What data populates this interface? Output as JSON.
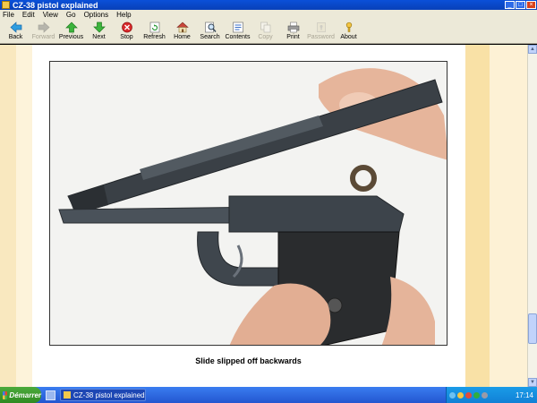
{
  "window": {
    "title": "CZ-38 pistol explained"
  },
  "menu": [
    "File",
    "Edit",
    "View",
    "Go",
    "Options",
    "Help"
  ],
  "toolbar": [
    {
      "label": "Back",
      "icon": "back-arrow-icon",
      "enabled": true
    },
    {
      "label": "Forward",
      "icon": "forward-arrow-icon",
      "enabled": false
    },
    {
      "label": "Previous",
      "icon": "up-arrow-icon",
      "enabled": true
    },
    {
      "label": "Next",
      "icon": "down-arrow-icon",
      "enabled": true
    },
    {
      "label": "Stop",
      "icon": "stop-icon",
      "enabled": true
    },
    {
      "label": "Refresh",
      "icon": "refresh-icon",
      "enabled": true
    },
    {
      "label": "Home",
      "icon": "home-icon",
      "enabled": true
    },
    {
      "label": "Search",
      "icon": "search-icon",
      "enabled": true
    },
    {
      "label": "Contents",
      "icon": "contents-icon",
      "enabled": true
    },
    {
      "label": "Copy",
      "icon": "copy-icon",
      "enabled": false
    },
    {
      "label": "Print",
      "icon": "print-icon",
      "enabled": true
    },
    {
      "label": "Password",
      "icon": "password-icon",
      "enabled": false
    },
    {
      "label": "About",
      "icon": "about-icon",
      "enabled": true
    }
  ],
  "content": {
    "caption": "Slide slipped off backwards",
    "photo_alt": "pistol-with-slide-removed-photo"
  },
  "taskbar": {
    "start_label": "Démarrer",
    "task_label": "CZ-38 pistol explained",
    "clock": "17:14"
  },
  "colors": {
    "titlebar": "#0a50d8",
    "chrome": "#ece9d8",
    "stripe_left": "#f9e8bf",
    "stripe_right": "#f9e1a6",
    "taskbar": "#2356d0"
  }
}
